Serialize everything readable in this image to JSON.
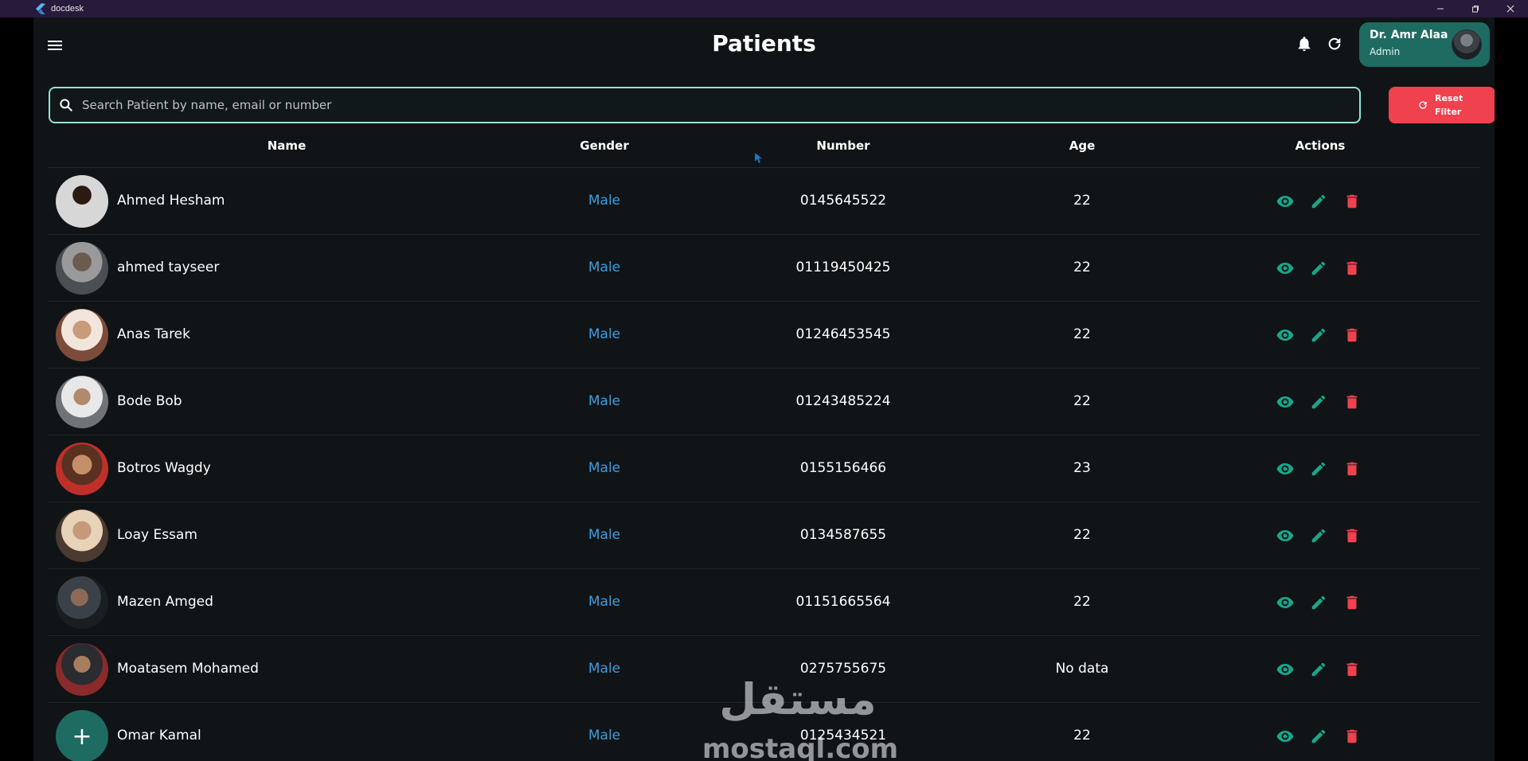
{
  "window": {
    "app_name": "docdesk",
    "controls": [
      "minimize",
      "restore",
      "close"
    ]
  },
  "header": {
    "title": "Patients",
    "user": {
      "name": "Dr. Amr Alaa",
      "role": "Admin"
    }
  },
  "search": {
    "placeholder": "Search Patient by name, email or number",
    "value": "",
    "reset_label": "Reset Filter"
  },
  "table": {
    "columns": {
      "name": "Name",
      "gender": "Gender",
      "number": "Number",
      "age": "Age",
      "actions": "Actions"
    },
    "rows": [
      {
        "name": "Ahmed Hesham",
        "gender": "Male",
        "number": "0145645522",
        "age": "22"
      },
      {
        "name": "ahmed tayseer",
        "gender": "Male",
        "number": "01119450425",
        "age": "22"
      },
      {
        "name": "Anas Tarek",
        "gender": "Male",
        "number": "01246453545",
        "age": "22"
      },
      {
        "name": "Bode Bob",
        "gender": "Male",
        "number": "01243485224",
        "age": "22"
      },
      {
        "name": "Botros Wagdy",
        "gender": "Male",
        "number": "0155156466",
        "age": "23"
      },
      {
        "name": "Loay Essam",
        "gender": "Male",
        "number": "0134587655",
        "age": "22"
      },
      {
        "name": "Mazen Amged",
        "gender": "Male",
        "number": "01151665564",
        "age": "22"
      },
      {
        "name": "Moatasem Mohamed",
        "gender": "Male",
        "number": "0275755675",
        "age": "No data"
      },
      {
        "name": "Omar Kamal",
        "gender": "Male",
        "number": "0125434521",
        "age": "22"
      }
    ]
  },
  "watermark": {
    "arabic": "مستقل",
    "latin": "mostaql.com"
  },
  "colors": {
    "background": "#101416",
    "accent_teal": "#1e6b62",
    "view_icon": "#1aa68a",
    "edit_icon": "#1aa68a",
    "delete_icon": "#f0414f",
    "gender_text": "#3f9de0",
    "search_border": "#8fe6da",
    "reset_button": "#f0414f"
  },
  "icons": {
    "menu": "menu-icon",
    "bell": "bell-icon",
    "refresh": "refresh-icon",
    "search": "search-icon",
    "view": "eye-icon",
    "edit": "pencil-icon",
    "delete": "trash-icon",
    "add": "plus-icon"
  }
}
